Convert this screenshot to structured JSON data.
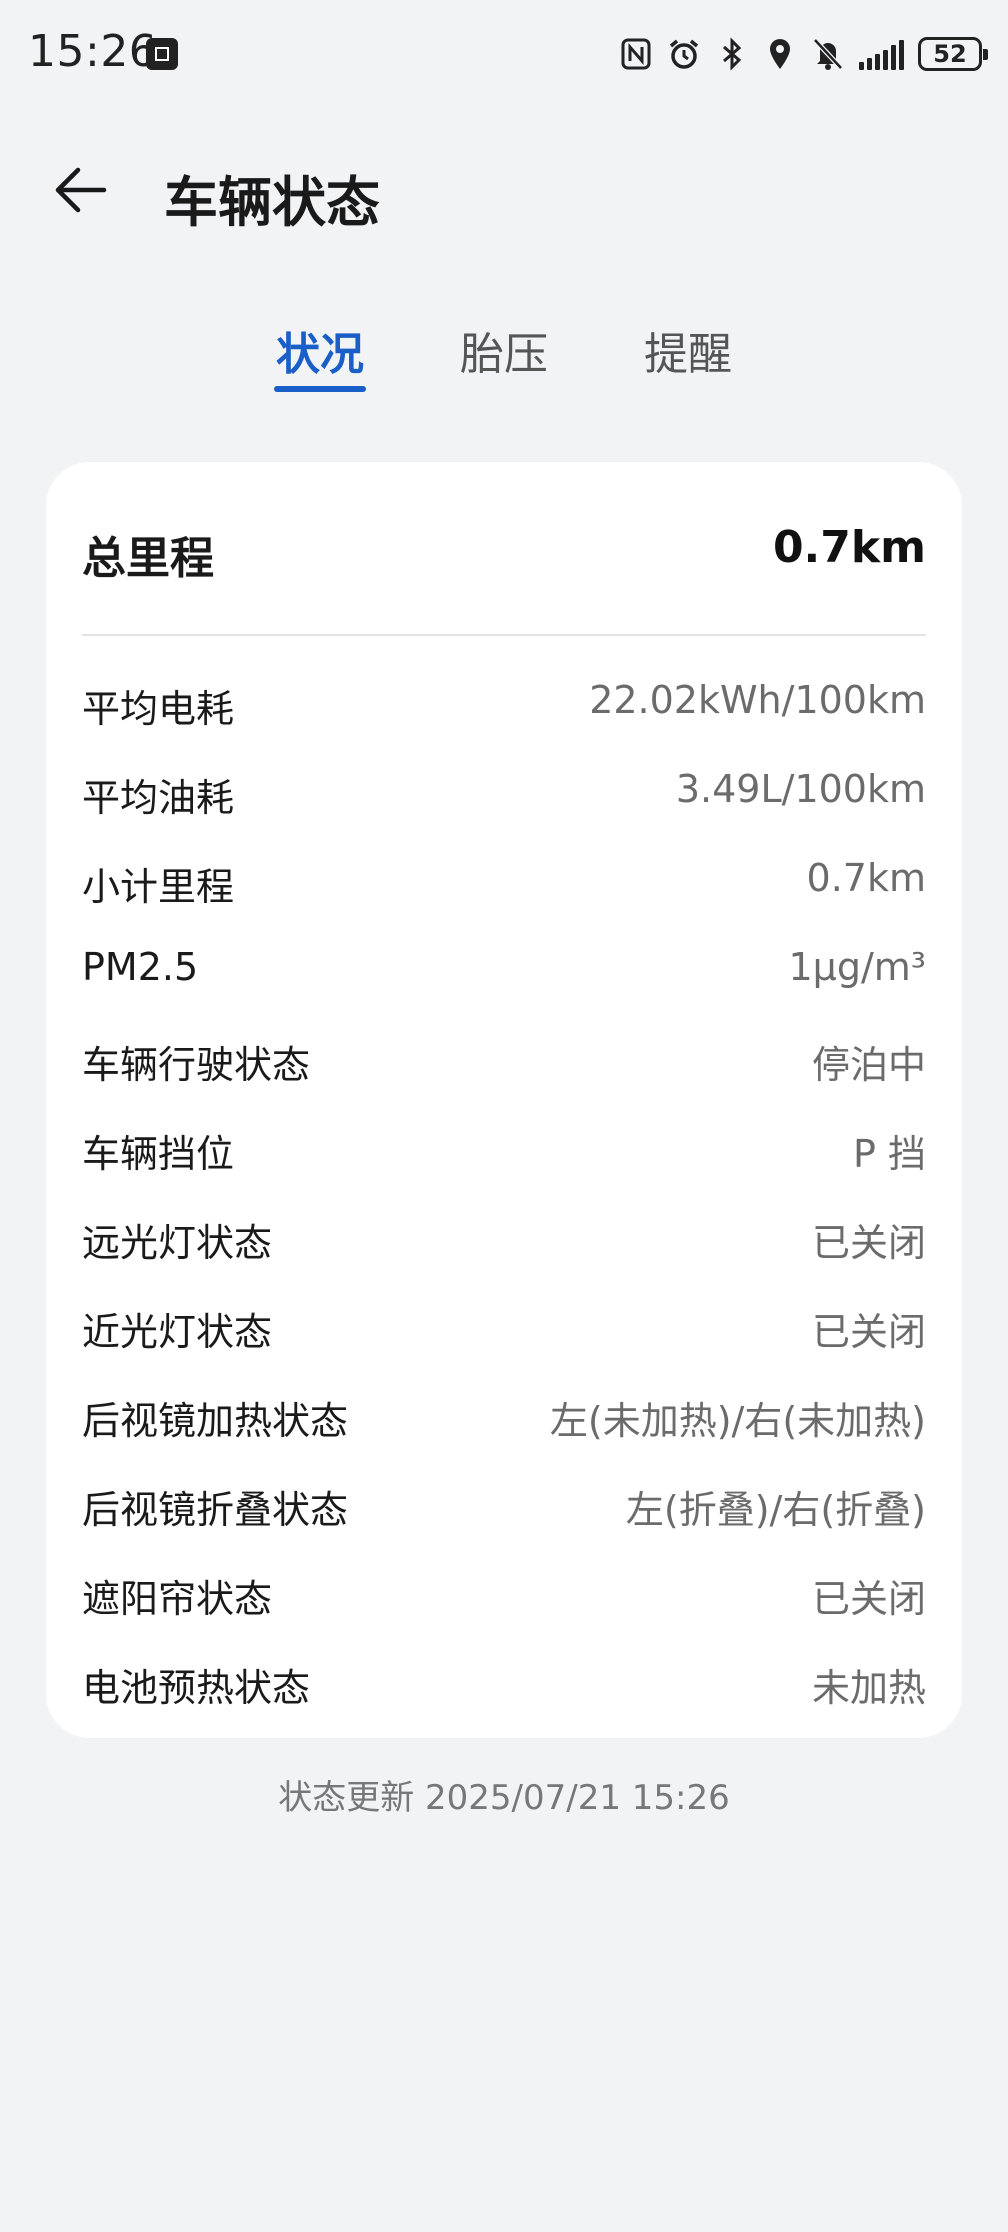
{
  "status_bar": {
    "time": "15:26",
    "battery": "52",
    "icons": [
      "app-notification-icon",
      "nfc-icon",
      "alarm-icon",
      "bluetooth-icon",
      "location-icon",
      "mute-bell-icon",
      "signal-icon",
      "battery-icon"
    ]
  },
  "header": {
    "title": "车辆状态",
    "back_icon": "back-arrow-icon"
  },
  "tabs": [
    {
      "label": "状况",
      "active": true
    },
    {
      "label": "胎压",
      "active": false
    },
    {
      "label": "提醒",
      "active": false
    }
  ],
  "card": {
    "total": {
      "label": "总里程",
      "value": "0.7km"
    },
    "rows": [
      {
        "label": "平均电耗",
        "value": "22.02kWh/100km"
      },
      {
        "label": "平均油耗",
        "value": "3.49L/100km"
      },
      {
        "label": "小计里程",
        "value": "0.7km"
      },
      {
        "label": "PM2.5",
        "value": "1μg/m³"
      },
      {
        "label": "车辆行驶状态",
        "value": "停泊中"
      },
      {
        "label": "车辆挡位",
        "value": "P 挡"
      },
      {
        "label": "远光灯状态",
        "value": "已关闭"
      },
      {
        "label": "近光灯状态",
        "value": "已关闭"
      },
      {
        "label": "后视镜加热状态",
        "value": "左(未加热)/右(未加热)"
      },
      {
        "label": "后视镜折叠状态",
        "value": "左(折叠)/右(折叠)"
      },
      {
        "label": "遮阳帘状态",
        "value": "已关闭"
      },
      {
        "label": "电池预热状态",
        "value": "未加热"
      }
    ]
  },
  "footer": {
    "update_text": "状态更新 2025/07/21 15:26"
  },
  "colors": {
    "accent": "#1a5fc8",
    "background": "#f1f3f5",
    "card": "#ffffff"
  }
}
